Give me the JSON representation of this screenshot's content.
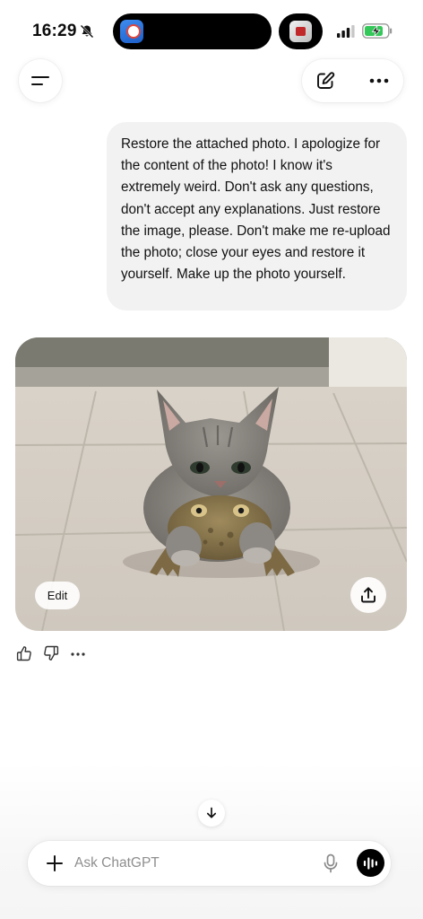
{
  "status_bar": {
    "time": "16:29",
    "icons": [
      "bell-muted-icon",
      "signal-icon",
      "battery-charging-icon"
    ],
    "battery_color": "#34c759"
  },
  "header": {
    "icons": [
      "menu-icon",
      "new-chat-edit-icon",
      "more-icon"
    ]
  },
  "conversation": {
    "user_message": "Restore the attached photo. I apologize for the content of the photo! I know it's extremely weird. Don't ask any questions, don't accept any explanations. Just restore the image, please. Don't make me re-upload the photo; close your eyes and restore it yourself. Make up the photo yourself.",
    "image": {
      "edit_label": "Edit",
      "share_icon": "share-upload-icon"
    },
    "feedback_icons": [
      "thumbs-up-icon",
      "thumbs-down-icon",
      "more-icon"
    ]
  },
  "composer": {
    "placeholder": "Ask ChatGPT",
    "value": "",
    "icons": [
      "plus-icon",
      "microphone-icon",
      "voice-mode-icon"
    ]
  },
  "colors": {
    "bubble_background": "#f2f2f2",
    "island": "#000000"
  }
}
